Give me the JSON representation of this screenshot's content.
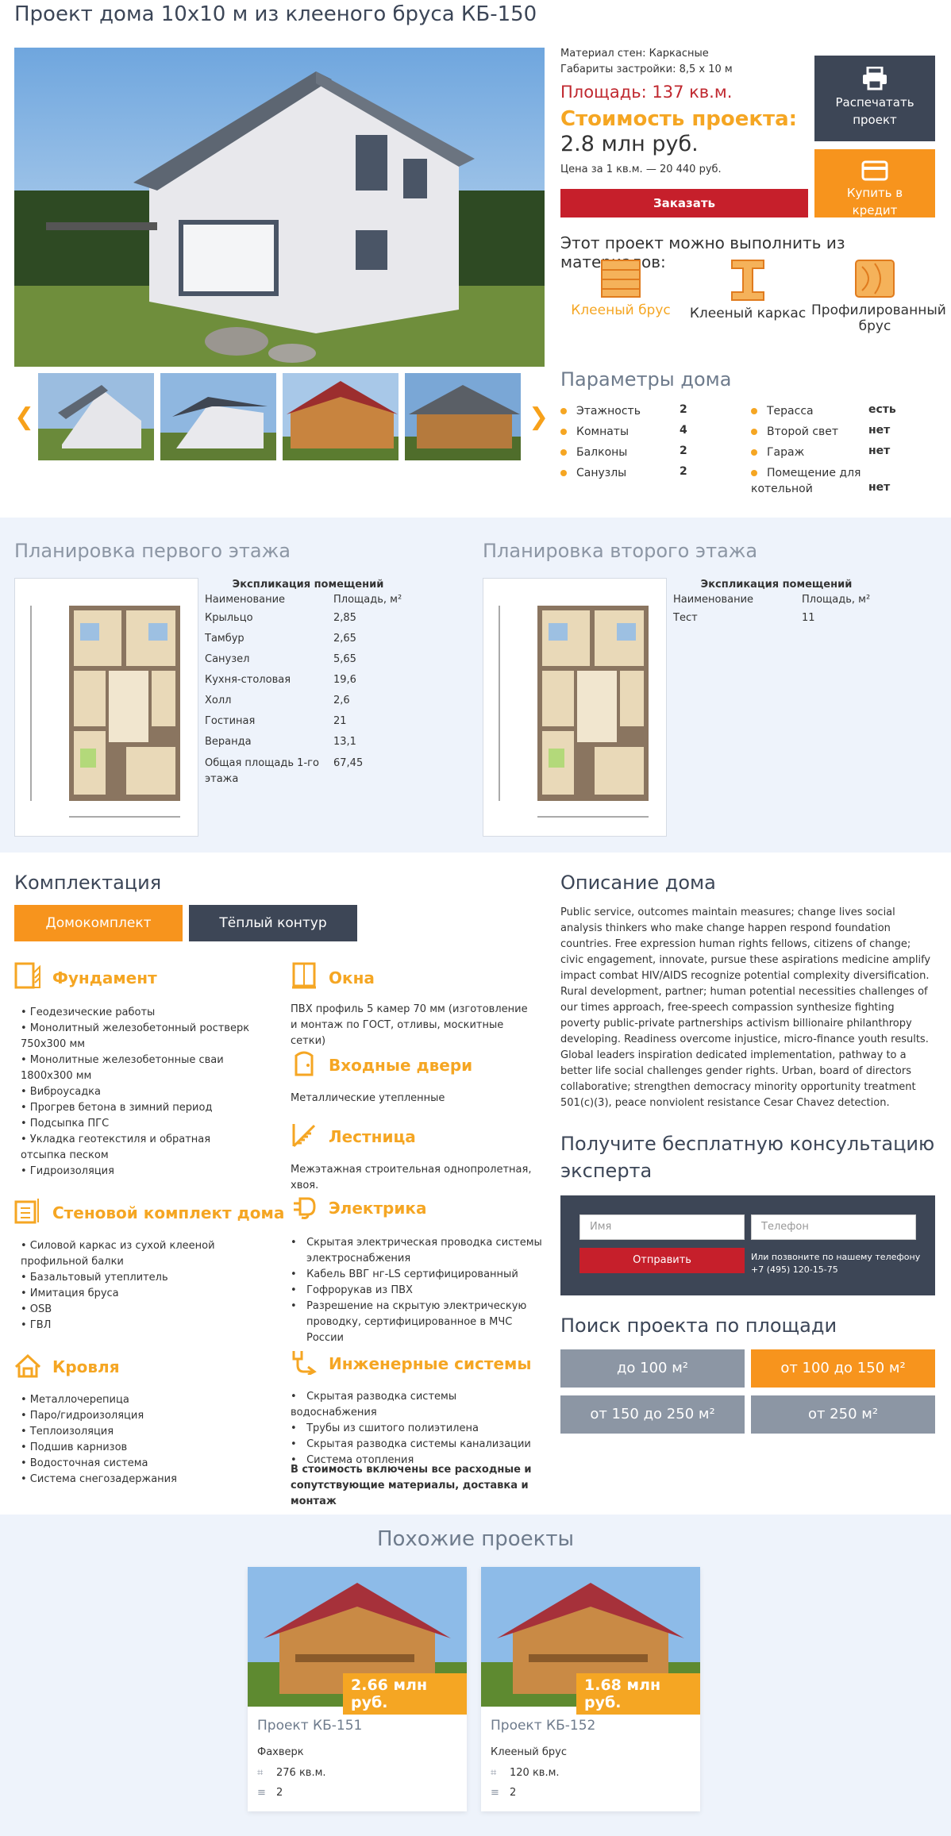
{
  "page": {
    "title": "Проект дома 10х10 м из клееного бруса КБ-150"
  },
  "info": {
    "walls": "Материал стен: Каркасные",
    "dims": "Габариты застройки: 8,5 х 10 м",
    "area": "Площадь: 137 кв.м.",
    "cost_label": "Стоимость проекта:",
    "cost_value": "2.8 млн руб.",
    "per_sqm": "Цена за 1 кв.м. — 20 440 руб.",
    "order": "Заказать",
    "print": "Распечатать проект",
    "credit": "Купить в кредит"
  },
  "materials": {
    "heading": "Этот проект можно выполнить из материалов:",
    "items": [
      "Клееный брус",
      "Клееный каркас",
      "Профилированный брус"
    ]
  },
  "params": {
    "heading": "Параметры дома",
    "left": [
      {
        "label": "Этажность",
        "value": "2"
      },
      {
        "label": "Комнаты",
        "value": "4"
      },
      {
        "label": "Балконы",
        "value": "2"
      },
      {
        "label": "Санузлы",
        "value": "2"
      }
    ],
    "right": [
      {
        "label": "Терасса",
        "value": "есть"
      },
      {
        "label": "Второй свет",
        "value": "нет"
      },
      {
        "label": "Гараж",
        "value": "нет"
      },
      {
        "label": "Помещение для котельной",
        "value": "нет"
      }
    ]
  },
  "plans": [
    {
      "heading": "Планировка первого этажа",
      "expl": "Экспликация помещений",
      "col1": "Наименование",
      "col2": "Площадь, м²",
      "rows": [
        [
          "Крыльцо",
          "2,85"
        ],
        [
          "Тамбур",
          "2,65"
        ],
        [
          "Санузел",
          "5,65"
        ],
        [
          "Кухня-столовая",
          "19,6"
        ],
        [
          "Холл",
          "2,6"
        ],
        [
          "Гостиная",
          "21"
        ],
        [
          "Веранда",
          "13,1"
        ],
        [
          "Общая площадь 1-го этажа",
          "67,45"
        ]
      ]
    },
    {
      "heading": "Планировка второго этажа",
      "expl": "Экспликация помещений",
      "col1": "Наименование",
      "col2": "Площадь, м²",
      "rows": [
        [
          "Тест",
          "11"
        ]
      ]
    }
  ],
  "komplekt": {
    "heading": "Комплектация",
    "tab1": "Домокомплект",
    "tab2": "Тёплый контур",
    "fund_h": "Фундамент",
    "fund": [
      "• Геодезические работы",
      "• Монолитный железобетонный ростверк 750х300 мм",
      "• Монолитные железобетонные сваи 1800х300 мм",
      "• Виброусадка",
      "• Прогрев бетона в зимний период",
      "• Подсыпка ПГС",
      "• Укладка геотекстиля и обратная отсыпка песком",
      "• Гидроизоляция"
    ],
    "wall_h": "Стеновой комплект дома",
    "wall": [
      "• Силовой каркас из сухой клееной профильной балки",
      "• Базальтовый утеплитель",
      "• Имитация бруса",
      "• OSB",
      "• ГВЛ"
    ],
    "roof_h": "Кровля",
    "roof": [
      "• Металлочерепица",
      "• Паро/гидроизоляция",
      "• Теплоизоляция",
      "• Подшив карнизов",
      "• Водосточная система",
      "• Система снегозадержания"
    ],
    "win_h": "Окна",
    "win": "ПВХ профиль 5 камер 70 мм (изготовление и монтаж по ГОСТ, отливы, москитные сетки)",
    "door_h": "Входные двери",
    "door": "Металлические утепленные",
    "stair_h": "Лестница",
    "stair": "Межэтажная строительная однопролетная, хвоя.",
    "el_h": "Электрика",
    "el": [
      "Скрытая электрическая проводка системы электроснабжения",
      "Кабель ВВГ нг-LS сертифицированный",
      "Гофрорукав из ПВХ",
      "Разрешение на скрытую электрическую проводку, сертифицированное в МЧС России"
    ],
    "eng_h": "Инженерные системы",
    "eng": [
      "Скрытая разводка системы водоснабжения",
      "Трубы из сшитого полиэтилена",
      "Скрытая разводка системы канализации",
      "Система отопления"
    ],
    "note": "В стоимость включены все расходные и сопутствующие материалы, доставка и монтаж"
  },
  "description": {
    "heading": "Описание дома",
    "text": "Public service, outcomes maintain measures; change lives social analysis thinkers who make change happen respond foundation countries. Free expression human rights fellows, citizens of change; civic engagement, innovate, pursue these aspirations medicine amplify impact combat HIV/AIDS recognize potential complexity diversification. Rural development, partner; human potential necessities challenges of our times approach, free-speech compassion synthesize fighting poverty public-private partnerships activism billionaire philanthropy developing. Readiness overcome injustice, micro-finance youth results. Global leaders inspiration dedicated implementation, pathway to a better life social challenges gender rights. Urban, board of directors collaborative; strengthen democracy minority opportunity treatment 501(c)(3), peace nonviolent resistance Cesar Chavez detection."
  },
  "consult": {
    "heading": "Получите бесплатную консультацию эксперта",
    "name_ph": "Имя",
    "phone_ph": "Телефон",
    "send": "Отправить",
    "call": "Или позвоните по нашему телефону",
    "phone": "+7 (495) 120-15-75"
  },
  "search": {
    "heading": "Поиск проекта по площади",
    "opts": [
      "до 100 м²",
      "от 100 до 150 м²",
      "от 150 до 250 м²",
      "от 250 м²"
    ]
  },
  "similar": {
    "heading": "Похожие проекты",
    "cards": [
      {
        "price": "2.66 млн руб.",
        "name": "Проект КБ-151",
        "material": "Фахверк",
        "area": "276 кв.м.",
        "floors": "2"
      },
      {
        "price": "1.68 млн руб.",
        "name": "Проект КБ-152",
        "material": "Клееный брус",
        "area": "120 кв.м.",
        "floors": "2"
      }
    ]
  },
  "colors": {
    "accent": "#f5a623",
    "red": "#c61f2b",
    "dark": "#3d4656",
    "gray_btn": "#8c96a4"
  }
}
